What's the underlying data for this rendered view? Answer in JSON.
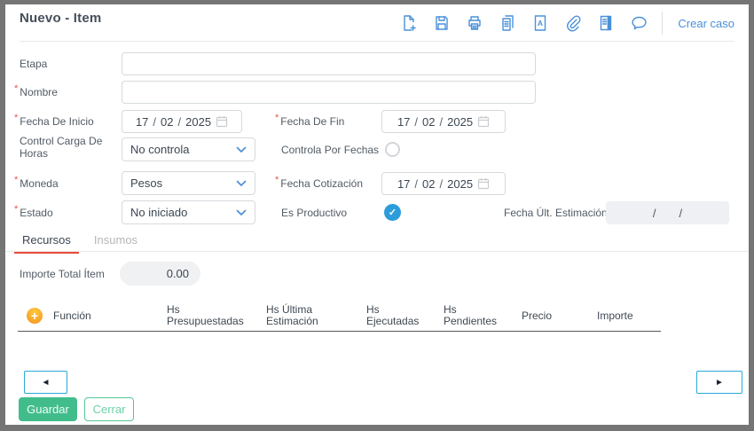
{
  "colors": {
    "frame": "#757575",
    "icon_blue": "#4a90d9",
    "checked_blue": "#2d9cdb",
    "tab_active_underline": "#e8493c",
    "save_green": "#41bd8b",
    "required_red": "#e8544b"
  },
  "window": {
    "title": "Nuevo - Item"
  },
  "toolbar": {
    "icons": [
      "new-document",
      "save",
      "print",
      "copy",
      "text-document",
      "attachment",
      "book",
      "comment"
    ],
    "link": "Crear caso"
  },
  "form": {
    "sep": "/",
    "etapa": {
      "label": "Etapa",
      "value": ""
    },
    "nombre": {
      "label": "Nombre",
      "required": true,
      "value": ""
    },
    "fecha_de_inicio": {
      "label": "Fecha De Inicio",
      "required": true,
      "day": "17",
      "month": "02",
      "year": "2025"
    },
    "fecha_de_fin": {
      "label": "Fecha De Fin",
      "required": true,
      "day": "17",
      "month": "02",
      "year": "2025"
    },
    "control_carga": {
      "label": "Control Carga De Horas",
      "value": "No controla"
    },
    "controla_por_fechas": {
      "label": "Controla Por Fechas",
      "checked": false
    },
    "moneda": {
      "label": "Moneda",
      "required": true,
      "value": "Pesos"
    },
    "fecha_cotizacion": {
      "label": "Fecha Cotización",
      "required": true,
      "day": "17",
      "month": "02",
      "year": "2025"
    },
    "estado": {
      "label": "Estado",
      "required": true,
      "value": "No iniciado"
    },
    "es_productivo": {
      "label": "Es Productivo",
      "checked": true,
      "check_glyph": "✓"
    },
    "fecha_ult_estimacion": {
      "label": "Fecha Últ. Estimación",
      "value_empty_seps": "/      /"
    }
  },
  "tabs": [
    {
      "label": "Recursos",
      "active": true
    },
    {
      "label": "Insumos",
      "active": false
    }
  ],
  "importe_total": {
    "label": "Importe Total Ítem",
    "value": "0.00"
  },
  "table": {
    "add_label": "+",
    "headers": [
      "Función",
      "Hs Presupuestadas",
      "Hs Última Estimación",
      "Hs Ejecutadas",
      "Hs Pendientes",
      "Precio",
      "Importe"
    ],
    "rows": []
  },
  "pager": {
    "prev": "◄",
    "next": "►"
  },
  "footer": {
    "save": "Guardar",
    "close": "Cerrar"
  }
}
